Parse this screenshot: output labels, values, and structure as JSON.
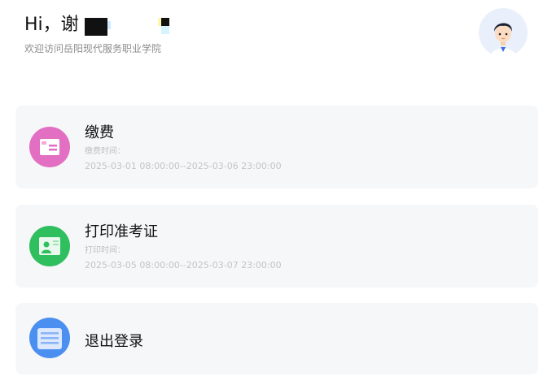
{
  "header": {
    "greeting": "Hi，谢",
    "subtitle": "欢迎访问岳阳现代服务职业学院"
  },
  "avatar": {
    "icon": "user-avatar-icon"
  },
  "cards": [
    {
      "title": "缴费",
      "time_label": "缴费时间：",
      "time_range": "2025-03-01 08:00:00--2025-03-06 23:00:00",
      "icon": "payment-card-icon",
      "icon_color": "#e36fc2"
    },
    {
      "title": "打印准考证",
      "time_label": "打印时间：",
      "time_range": "2025-03-05 08:00:00--2025-03-07 23:00:00",
      "icon": "admission-ticket-icon",
      "icon_color": "#2fbf5f"
    },
    {
      "title": "退出登录",
      "icon": "logout-list-icon",
      "icon_color": "#4b8ff0"
    }
  ]
}
